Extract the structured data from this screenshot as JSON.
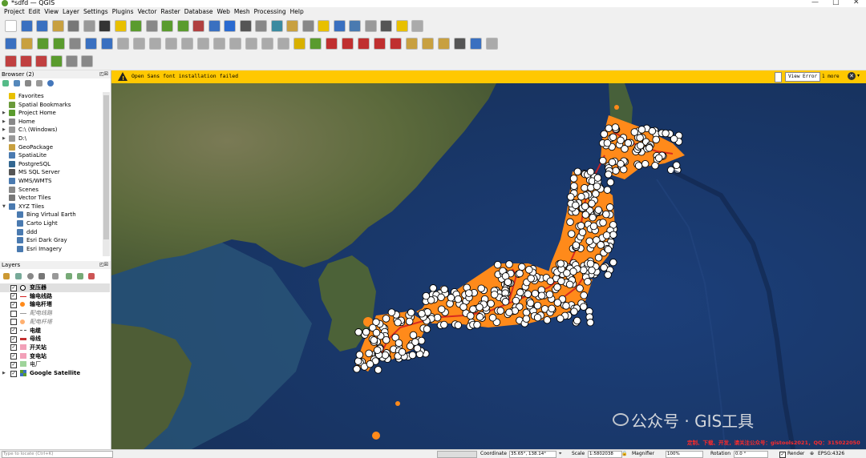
{
  "window": {
    "title": "*sdfd — QGIS",
    "min": "—",
    "max": "□",
    "close": "✕"
  },
  "menubar": [
    "Project",
    "Edit",
    "View",
    "Layer",
    "Settings",
    "Plugins",
    "Vector",
    "Raster",
    "Database",
    "Web",
    "Mesh",
    "Processing",
    "Help"
  ],
  "browser": {
    "title": "Browser (2)",
    "items": [
      {
        "label": "Favorites",
        "icon": "star-icon",
        "color": "#e8c000"
      },
      {
        "label": "Spatial Bookmarks",
        "icon": "bookmark-icon",
        "color": "#6a9a3a"
      },
      {
        "label": "Project Home",
        "icon": "project-home-icon",
        "color": "#5a9b2e"
      },
      {
        "label": "Home",
        "icon": "home-icon",
        "color": "#888"
      },
      {
        "label": "C:\\ (Windows)",
        "icon": "drive-icon",
        "color": "#999"
      },
      {
        "label": "D:\\",
        "icon": "drive-icon",
        "color": "#999"
      },
      {
        "label": "GeoPackage",
        "icon": "geopackage-icon",
        "color": "#c8a040"
      },
      {
        "label": "SpatiaLite",
        "icon": "spatialite-icon",
        "color": "#4a7ab0"
      },
      {
        "label": "PostgreSQL",
        "icon": "postgresql-icon",
        "color": "#336791"
      },
      {
        "label": "MS SQL Server",
        "icon": "mssql-icon",
        "color": "#555"
      },
      {
        "label": "WMS/WMTS",
        "icon": "wms-icon",
        "color": "#4a7ab0"
      },
      {
        "label": "Scenes",
        "icon": "scenes-icon",
        "color": "#888"
      },
      {
        "label": "Vector Tiles",
        "icon": "vector-tiles-icon",
        "color": "#777"
      },
      {
        "label": "XYZ Tiles",
        "icon": "xyz-tiles-icon",
        "color": "#4a7ab0"
      },
      {
        "label": "Bing Virtual Earth",
        "icon": "tile-icon",
        "color": "#4a7ab0"
      },
      {
        "label": "Carto Light",
        "icon": "tile-icon",
        "color": "#4a7ab0"
      },
      {
        "label": "ddd",
        "icon": "tile-icon",
        "color": "#4a7ab0"
      },
      {
        "label": "Esri Dark Gray",
        "icon": "tile-icon",
        "color": "#4a7ab0"
      },
      {
        "label": "Esri Imagery",
        "icon": "tile-icon",
        "color": "#4a7ab0"
      }
    ]
  },
  "layers": {
    "title": "Layers",
    "items": [
      {
        "label": "变压器",
        "checked": true,
        "sym": "point-white",
        "bold": true,
        "highlight": true
      },
      {
        "label": "输电线路",
        "checked": true,
        "sym": "line-red",
        "bold": true
      },
      {
        "label": "输电杆塔",
        "checked": true,
        "sym": "point-orange",
        "bold": true
      },
      {
        "label": "配电线路",
        "checked": false,
        "sym": "line-gray",
        "bold": false
      },
      {
        "label": "配电杆塔",
        "checked": false,
        "sym": "point-orange-light",
        "bold": false
      },
      {
        "label": "电缆",
        "checked": true,
        "sym": "dash",
        "bold": true
      },
      {
        "label": "母线",
        "checked": true,
        "sym": "line-thick-red",
        "bold": true
      },
      {
        "label": "开关站",
        "checked": true,
        "sym": "fill-pink",
        "bold": true
      },
      {
        "label": "变电站",
        "checked": true,
        "sym": "fill-pink",
        "bold": true
      },
      {
        "label": "电厂",
        "checked": true,
        "sym": "fill-green",
        "bold": false
      },
      {
        "label": "Google Satellite",
        "checked": true,
        "sym": "raster",
        "bold": true
      }
    ]
  },
  "message": {
    "text": "Open Sans font installation failed",
    "view_error": "View Error",
    "more": "1 more"
  },
  "status": {
    "locate_placeholder": "Type to locate (Ctrl+K)",
    "coordinate_label": "Coordinate",
    "coordinate": "35.65°, 138.14°",
    "scale_label": "Scale",
    "scale": "1:5802038",
    "magnifier_label": "Magnifier",
    "magnifier": "100%",
    "rotation_label": "Rotation",
    "rotation": "0.0 °",
    "render_label": "Render",
    "crs": "EPSG:4326"
  },
  "watermark": {
    "brand": "公众号 · GIS工具",
    "notice": "定制、下载、开发，请关注公众号：gistools2021，QQ：315022050"
  },
  "colors": {
    "message_bar": "#ffc800",
    "point_fill": "#ffffff",
    "buffer": "#ff8a1a",
    "line": "#d42020",
    "ocean": "#1f3a6b"
  }
}
